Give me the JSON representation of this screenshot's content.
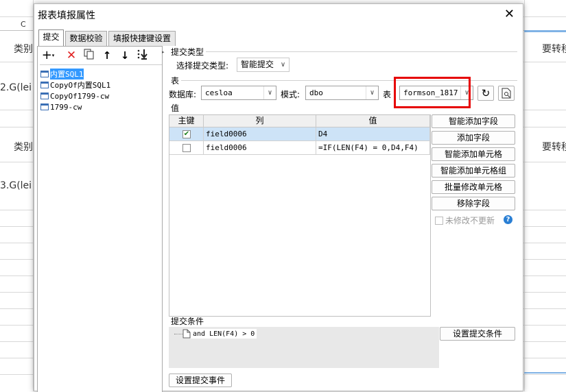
{
  "background": {
    "col_c": "C",
    "cat1": "类别",
    "cat2": "类别",
    "frag1": "2.G(lei",
    "frag2": "3.G(lei",
    "right1": "要转移",
    "right2": "要转移"
  },
  "dialog": {
    "title": "报表填报属性",
    "tabs": [
      "提交",
      "数据校验",
      "填报快捷键设置"
    ],
    "tree": [
      "内置SQL1",
      "CopyOf内置SQL1",
      "CopyOf1799-cw",
      "1799-cw"
    ],
    "submit_type": {
      "section": "提交类型",
      "label": "选择提交类型:",
      "value": "智能提交"
    },
    "table": {
      "section": "表",
      "db_label": "数据库:",
      "db_value": "cesloa",
      "schema_label": "模式:",
      "schema_value": "dbo",
      "table_label": "表",
      "table_value": "formson_1817"
    },
    "values": {
      "section": "值",
      "headers": [
        "主键",
        "列",
        "值"
      ],
      "rows": [
        {
          "key": true,
          "col": "field0006",
          "val": "D4"
        },
        {
          "key": false,
          "col": "field0006",
          "val": "=IF(LEN(F4) = 0,D4,F4)"
        }
      ]
    },
    "buttons": [
      "智能添加字段",
      "添加字段",
      "智能添加单元格",
      "智能添加单元格组",
      "批量修改单元格",
      "移除字段"
    ],
    "unchanged_label": "未修改不更新",
    "condition": {
      "section": "提交条件",
      "item": "and LEN(F4) > 0",
      "button": "设置提交条件"
    },
    "event_button": "设置提交事件"
  },
  "colors": {
    "highlight_box": "#e60000",
    "selection": "#3399ff",
    "row_selected": "#cde3f7"
  }
}
